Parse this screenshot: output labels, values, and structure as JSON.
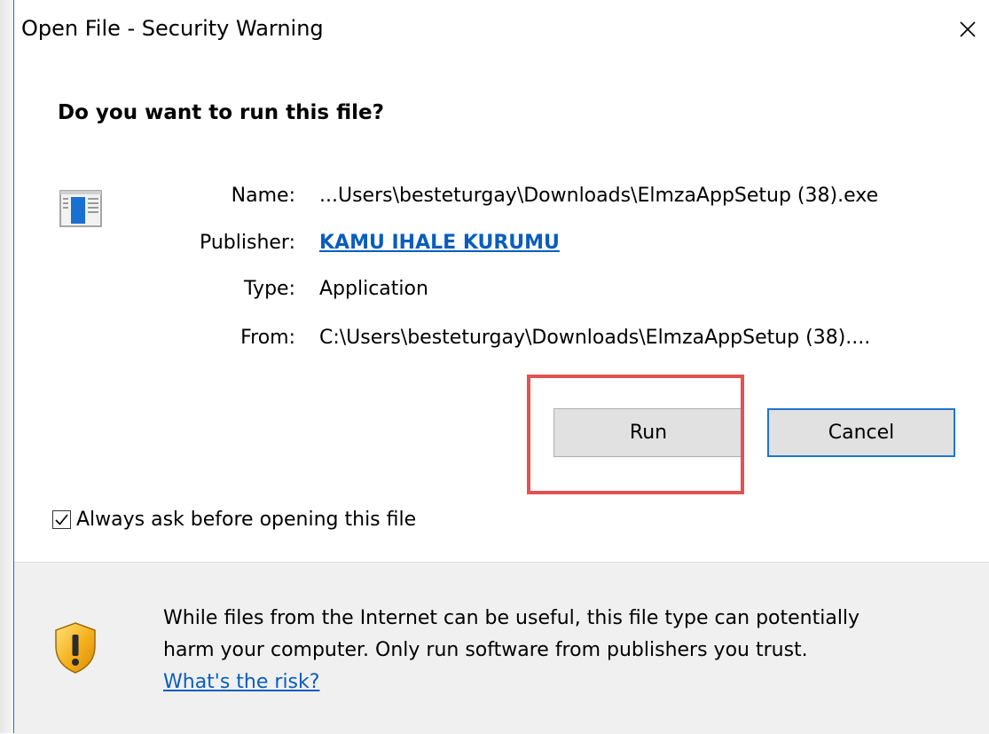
{
  "window": {
    "title": "Open File - Security Warning",
    "close_glyph": "✕"
  },
  "dialog": {
    "heading": "Do you want to run this file?",
    "file_icon": "application-window-icon",
    "fields": [
      {
        "label": "Name:",
        "value": "...Users\\besteturgay\\Downloads\\ElmzaAppSetup (38).exe"
      },
      {
        "label": "Publisher:",
        "value": "KAMU IHALE KURUMU"
      },
      {
        "label": "Type:",
        "value": "Application"
      },
      {
        "label": "From:",
        "value": "C:\\Users\\besteturgay\\Downloads\\ElmzaAppSetup (38)...."
      }
    ],
    "buttons": {
      "run": "Run",
      "cancel": "Cancel"
    },
    "checkbox": {
      "label": "Always ask before opening this file",
      "checked": true
    }
  },
  "warning": {
    "icon": "shield-warning-icon",
    "line1": "While files from the Internet can be useful, this file type can potentially",
    "line2": "harm your computer. Only run software from publishers you trust.",
    "link": "What's the risk?"
  },
  "colors": {
    "accent": "#1f75ce",
    "link": "#0a5dbd",
    "highlight": "#e35252",
    "footer_bg": "#f0f0f0"
  }
}
